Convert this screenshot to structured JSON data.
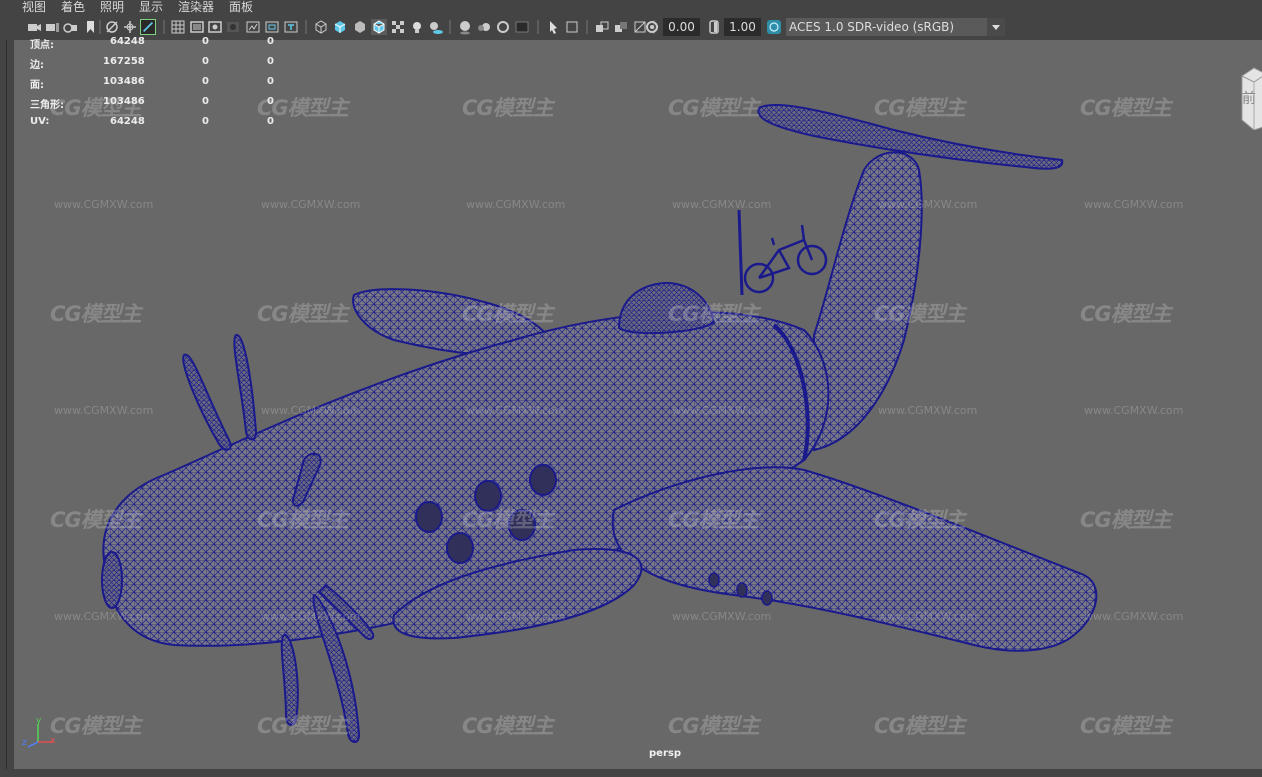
{
  "menubar": {
    "items": [
      "视图",
      "着色",
      "照明",
      "显示",
      "渲染器",
      "面板"
    ]
  },
  "toolbar": {
    "exposure_value": "0.00",
    "gamma_value": "1.00",
    "color_space": "ACES 1.0 SDR-video (sRGB)"
  },
  "hud": {
    "rows": [
      {
        "label": "顶点:",
        "c1": "64248",
        "c2": "0",
        "c3": "0"
      },
      {
        "label": "边:",
        "c1": "167258",
        "c2": "0",
        "c3": "0"
      },
      {
        "label": "面:",
        "c1": "103486",
        "c2": "0",
        "c3": "0"
      },
      {
        "label": "三角形:",
        "c1": "103486",
        "c2": "0",
        "c3": "0"
      },
      {
        "label": "UV:",
        "c1": "64248",
        "c2": "0",
        "c3": "0"
      }
    ]
  },
  "watermark": {
    "logo_text": "CG模型主",
    "url_text": "www.CGMXW.com"
  },
  "viewcube": {
    "face_label": "前"
  },
  "camera_label": "persp",
  "axis": {
    "x": "x",
    "y": "y",
    "z": "z"
  },
  "colors": {
    "wireframe": "#1a1a8c",
    "viewport_bg": "#686868",
    "ui_bg": "#444444",
    "accent_select": "#3bb0d9"
  }
}
